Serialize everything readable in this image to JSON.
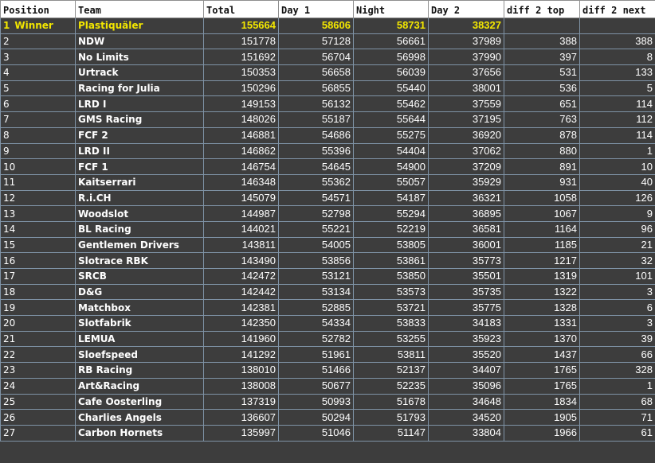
{
  "headers": [
    "Position",
    "Team",
    "Total",
    "Day 1",
    "Night",
    "Day 2",
    "diff 2 top",
    "diff 2 next"
  ],
  "winner": {
    "position": "1",
    "label": "Winner",
    "team": "Plastiquäler",
    "total": "155664",
    "day1": "58606",
    "night": "58731",
    "day2": "38327",
    "diff_top": "",
    "diff_next": ""
  },
  "rows": [
    {
      "position": "2",
      "team": "NDW",
      "total": "151778",
      "day1": "57128",
      "night": "56661",
      "day2": "37989",
      "diff_top": "388",
      "diff_next": "388"
    },
    {
      "position": "3",
      "team": "No Limits",
      "total": "151692",
      "day1": "56704",
      "night": "56998",
      "day2": "37990",
      "diff_top": "397",
      "diff_next": "8"
    },
    {
      "position": "4",
      "team": "Urtrack",
      "total": "150353",
      "day1": "56658",
      "night": "56039",
      "day2": "37656",
      "diff_top": "531",
      "diff_next": "133"
    },
    {
      "position": "5",
      "team": "Racing for Julia",
      "total": "150296",
      "day1": "56855",
      "night": "55440",
      "day2": "38001",
      "diff_top": "536",
      "diff_next": "5"
    },
    {
      "position": "6",
      "team": "LRD I",
      "total": "149153",
      "day1": "56132",
      "night": "55462",
      "day2": "37559",
      "diff_top": "651",
      "diff_next": "114"
    },
    {
      "position": "7",
      "team": "GMS Racing",
      "total": "148026",
      "day1": "55187",
      "night": "55644",
      "day2": "37195",
      "diff_top": "763",
      "diff_next": "112"
    },
    {
      "position": "8",
      "team": "FCF 2",
      "total": "146881",
      "day1": "54686",
      "night": "55275",
      "day2": "36920",
      "diff_top": "878",
      "diff_next": "114"
    },
    {
      "position": "9",
      "team": "LRD II",
      "total": "146862",
      "day1": "55396",
      "night": "54404",
      "day2": "37062",
      "diff_top": "880",
      "diff_next": "1"
    },
    {
      "position": "10",
      "team": "FCF 1",
      "total": "146754",
      "day1": "54645",
      "night": "54900",
      "day2": "37209",
      "diff_top": "891",
      "diff_next": "10"
    },
    {
      "position": "11",
      "team": "Kaitserrari",
      "total": "146348",
      "day1": "55362",
      "night": "55057",
      "day2": "35929",
      "diff_top": "931",
      "diff_next": "40"
    },
    {
      "position": "12",
      "team": "R.i.CH",
      "total": "145079",
      "day1": "54571",
      "night": "54187",
      "day2": "36321",
      "diff_top": "1058",
      "diff_next": "126"
    },
    {
      "position": "13",
      "team": "Woodslot",
      "total": "144987",
      "day1": "52798",
      "night": "55294",
      "day2": "36895",
      "diff_top": "1067",
      "diff_next": "9"
    },
    {
      "position": "14",
      "team": "BL Racing",
      "total": "144021",
      "day1": "55221",
      "night": "52219",
      "day2": "36581",
      "diff_top": "1164",
      "diff_next": "96"
    },
    {
      "position": "15",
      "team": "Gentlemen Drivers",
      "total": "143811",
      "day1": "54005",
      "night": "53805",
      "day2": "36001",
      "diff_top": "1185",
      "diff_next": "21"
    },
    {
      "position": "16",
      "team": "Slotrace RBK",
      "total": "143490",
      "day1": "53856",
      "night": "53861",
      "day2": "35773",
      "diff_top": "1217",
      "diff_next": "32"
    },
    {
      "position": "17",
      "team": "SRCB",
      "total": "142472",
      "day1": "53121",
      "night": "53850",
      "day2": "35501",
      "diff_top": "1319",
      "diff_next": "101"
    },
    {
      "position": "18",
      "team": "D&G",
      "total": "142442",
      "day1": "53134",
      "night": "53573",
      "day2": "35735",
      "diff_top": "1322",
      "diff_next": "3"
    },
    {
      "position": "19",
      "team": "Matchbox",
      "total": "142381",
      "day1": "52885",
      "night": "53721",
      "day2": "35775",
      "diff_top": "1328",
      "diff_next": "6"
    },
    {
      "position": "20",
      "team": "Slotfabrik",
      "total": "142350",
      "day1": "54334",
      "night": "53833",
      "day2": "34183",
      "diff_top": "1331",
      "diff_next": "3"
    },
    {
      "position": "21",
      "team": "LEMUA",
      "total": "141960",
      "day1": "52782",
      "night": "53255",
      "day2": "35923",
      "diff_top": "1370",
      "diff_next": "39"
    },
    {
      "position": "22",
      "team": "Sloefspeed",
      "total": "141292",
      "day1": "51961",
      "night": "53811",
      "day2": "35520",
      "diff_top": "1437",
      "diff_next": "66"
    },
    {
      "position": "23",
      "team": "RB Racing",
      "total": "138010",
      "day1": "51466",
      "night": "52137",
      "day2": "34407",
      "diff_top": "1765",
      "diff_next": "328"
    },
    {
      "position": "24",
      "team": "Art&Racing",
      "total": "138008",
      "day1": "50677",
      "night": "52235",
      "day2": "35096",
      "diff_top": "1765",
      "diff_next": "1"
    },
    {
      "position": "25",
      "team": "Cafe Oosterling",
      "total": "137319",
      "day1": "50993",
      "night": "51678",
      "day2": "34648",
      "diff_top": "1834",
      "diff_next": "68"
    },
    {
      "position": "26",
      "team": "Charlies Angels",
      "total": "136607",
      "day1": "50294",
      "night": "51793",
      "day2": "34520",
      "diff_top": "1905",
      "diff_next": "71"
    },
    {
      "position": "27",
      "team": "Carbon Hornets",
      "total": "135997",
      "day1": "51046",
      "night": "51147",
      "day2": "33804",
      "diff_top": "1966",
      "diff_next": "61"
    }
  ]
}
